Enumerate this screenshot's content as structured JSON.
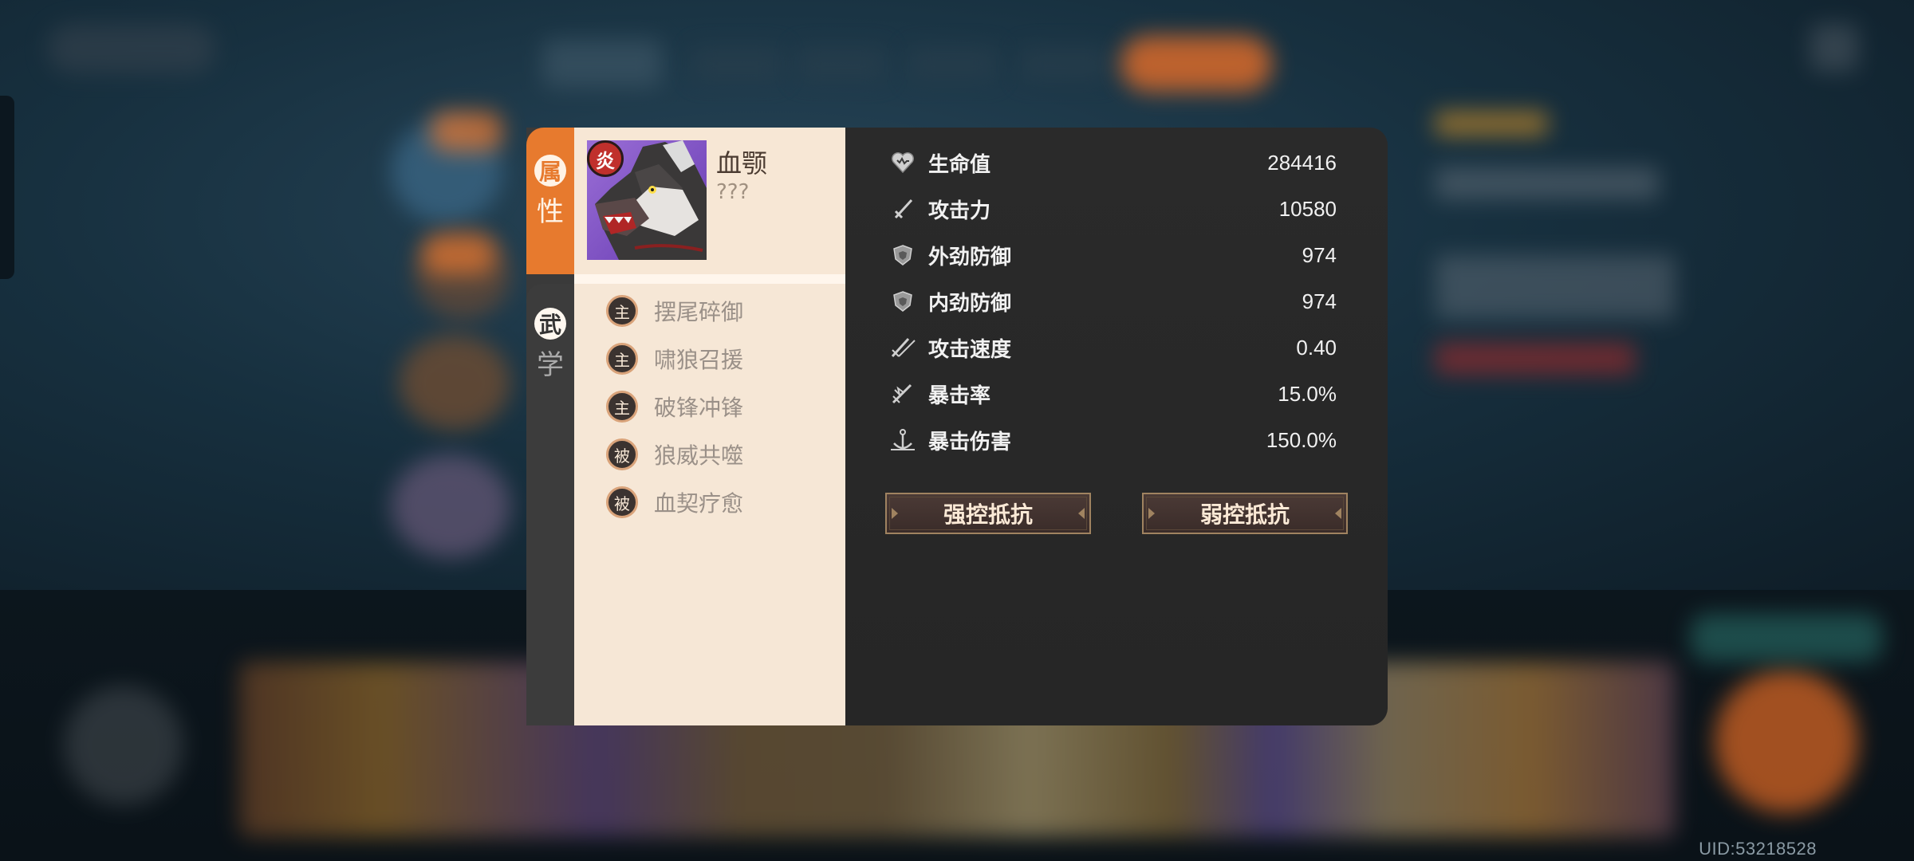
{
  "uid": "UID:53218528",
  "side_tabs": [
    {
      "char1": "属",
      "char2": "性",
      "active": true
    },
    {
      "char1": "武",
      "char2": "学",
      "active": false
    }
  ],
  "hero": {
    "name": "血颚",
    "subtitle": "???",
    "element": "炎",
    "portrait_icon": "wolf-portrait"
  },
  "skills": [
    {
      "type": "主",
      "name": "摆尾碎御"
    },
    {
      "type": "主",
      "name": "啸狼召援"
    },
    {
      "type": "主",
      "name": "破锋冲锋"
    },
    {
      "type": "被",
      "name": "狼威共噬"
    },
    {
      "type": "被",
      "name": "血契疗愈"
    }
  ],
  "stats": [
    {
      "icon": "heart-icon",
      "label": "生命值",
      "value": "284416"
    },
    {
      "icon": "sword-icon",
      "label": "攻击力",
      "value": "10580"
    },
    {
      "icon": "shield-icon",
      "label": "外劲防御",
      "value": "974"
    },
    {
      "icon": "shield-icon",
      "label": "内劲防御",
      "value": "974"
    },
    {
      "icon": "double-sword-icon",
      "label": "攻击速度",
      "value": "0.40"
    },
    {
      "icon": "crit-icon",
      "label": "暴击率",
      "value": "15.0%"
    },
    {
      "icon": "anchor-icon",
      "label": "暴击伤害",
      "value": "150.0%"
    }
  ],
  "buttons": {
    "strong_resist": "强控抵抗",
    "weak_resist": "弱控抵抗"
  },
  "colors": {
    "accent_orange": "#e77a2e",
    "panel_dark": "#2a2a2a",
    "parchment": "#f6e7d6"
  }
}
